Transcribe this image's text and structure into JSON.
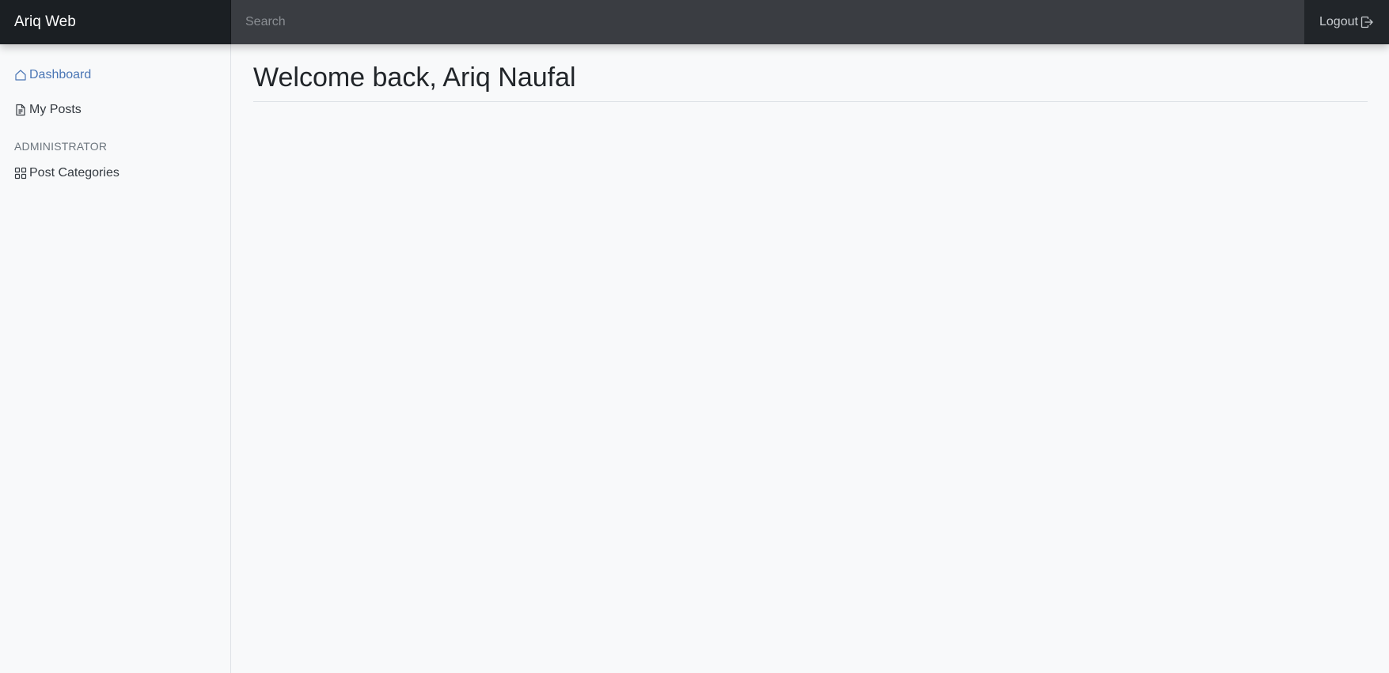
{
  "navbar": {
    "brand": "Ariq Web",
    "search_placeholder": "Search",
    "logout_label": "Logout"
  },
  "sidebar": {
    "items": [
      {
        "label": "Dashboard",
        "icon": "home-icon",
        "active": true
      },
      {
        "label": "My Posts",
        "icon": "file-text-icon",
        "active": false
      }
    ],
    "admin_heading": "ADMINISTRATOR",
    "admin_items": [
      {
        "label": "Post Categories",
        "icon": "grid-icon",
        "active": false
      }
    ]
  },
  "main": {
    "title": "Welcome back, Ariq Naufal"
  },
  "colors": {
    "navbar_bg": "#212529",
    "active_link": "#4a76b5",
    "page_bg": "#f8f9fa"
  }
}
